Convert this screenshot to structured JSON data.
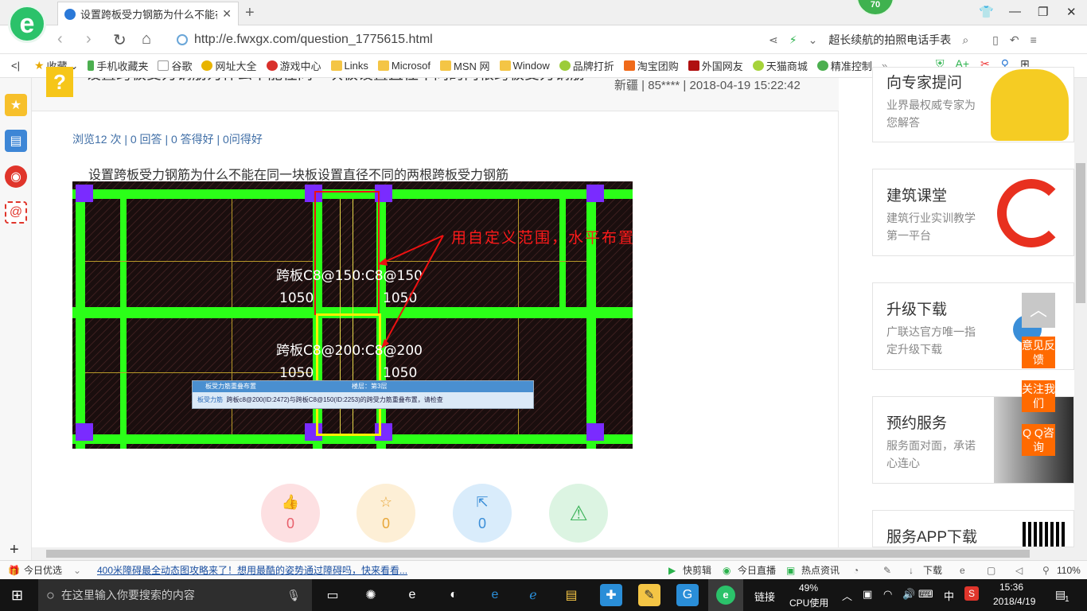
{
  "browser": {
    "tab_title": "设置跨板受力钢筋为什么不能在同",
    "badge": "70",
    "url": "http://e.fwxgx.com/question_1775615.html",
    "search_text": "超长续航的拍照电话手表"
  },
  "bookmarks": [
    "收藏",
    "手机收藏夹",
    "谷歌",
    "网址大全",
    "游戏中心",
    "Links",
    "Microsof",
    "MSN 网",
    "Window",
    "品牌打折",
    "淘宝团购",
    "外国网友",
    "天猫商城",
    "精准控制"
  ],
  "question": {
    "icon": "?",
    "title": "设置跨板受力钢筋为什么不能在同一块板设置直径不同的两根跨板受力钢筋",
    "meta": "新疆 | 85**** | 2018-04-19 15:22:42",
    "stats": "浏览12 次 | 0 回答 | 0 答得好 | 0问得好",
    "body": "设置跨板受力钢筋为什么不能在同一块板设置直径不同的两根跨板受力钢筋"
  },
  "cad": {
    "label1": "跨板C8@150:C8@150",
    "dim1a": "1050",
    "dim1b": "1050",
    "label2": "跨板C8@200:C8@200",
    "dim2a": "1050",
    "dim2b": "1050",
    "annotation": "用自定义范围，水平布置",
    "dialog_title": "板受力筋重叠布置",
    "dialog_floor": "楼层：第3层",
    "dialog_tag": "板受力筋",
    "dialog_msg": "跨板c8@200(ID:2472)与跨板C8@150(ID:2253)的跨受力筋重叠布置，请检查"
  },
  "actions": {
    "like": "0",
    "favorite": "0",
    "share": "0"
  },
  "sidebar": {
    "cards": [
      {
        "title": "向专家提问",
        "sub": "业界最权威专家为您解答"
      },
      {
        "title": "建筑课堂",
        "sub": "建筑行业实训教学第一平台"
      },
      {
        "title": "升级下载",
        "sub": "广联达官方唯一指定升级下载"
      },
      {
        "title": "预约服务",
        "sub": "服务面对面，承诺心连心"
      },
      {
        "title": "服务APP下载",
        "sub": ""
      }
    ],
    "float_feedback": "意见反馈",
    "float_follow": "关注我们",
    "float_qq": "Q Q咨询"
  },
  "statusbar": {
    "today": "今日优选",
    "news": "400米障碍最全动态图攻略来了！想用最酷的姿势通过障碍吗，快来看看...",
    "quickclip": "快剪辑",
    "live": "今日直播",
    "hotnews": "热点资讯",
    "download": "下载",
    "zoom": "110%"
  },
  "taskbar": {
    "search_placeholder": "在这里输入你要搜索的内容",
    "link": "链接",
    "cpu_pct": "49%",
    "cpu_label": "CPU使用",
    "ime": "中",
    "time": "15:36",
    "date": "2018/4/19",
    "notif": "1"
  }
}
